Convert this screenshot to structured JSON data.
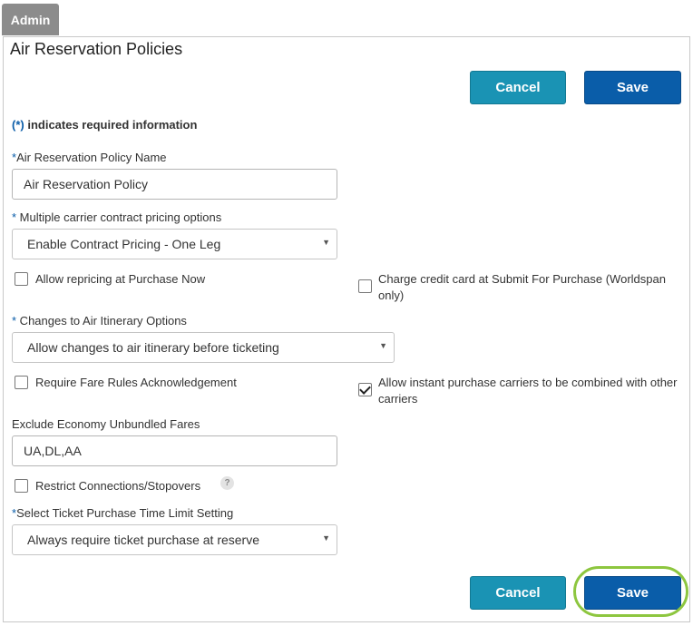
{
  "admin_tab": "Admin",
  "panel_title": "Air Reservation Policies",
  "buttons": {
    "cancel": "Cancel",
    "save": "Save"
  },
  "required_note": {
    "star": "(*)",
    "text": "indicates required information"
  },
  "fields": {
    "policy_name": {
      "asterisk": "*",
      "label": "Air Reservation Policy Name",
      "value": "Air Reservation Policy"
    },
    "contract_pricing": {
      "asterisk": "*",
      "label": " Multiple carrier contract pricing options",
      "selected": "Enable Contract Pricing - One Leg"
    },
    "allow_repricing": {
      "label": "Allow repricing at Purchase Now",
      "checked": false
    },
    "charge_credit_card": {
      "label": "Charge credit card at Submit For Purchase (Worldspan only)",
      "checked": false
    },
    "itinerary_options": {
      "asterisk": "*",
      "label": " Changes to Air Itinerary Options",
      "selected": "Allow changes to air itinerary before ticketing"
    },
    "fare_rules_ack": {
      "label": "Require Fare Rules Acknowledgement",
      "checked": false
    },
    "instant_purchase": {
      "label": "Allow instant purchase carriers to be combined with other carriers",
      "checked": true
    },
    "exclude_unbundled": {
      "label": "Exclude Economy Unbundled Fares",
      "value": "UA,DL,AA"
    },
    "restrict_connections": {
      "label": "Restrict Connections/Stopovers",
      "checked": false,
      "help_glyph": "?"
    },
    "ticket_time_limit": {
      "asterisk": "*",
      "label": "Select Ticket Purchase Time Limit Setting",
      "selected": "Always require ticket purchase at reserve"
    }
  },
  "icons": {
    "dropdown_arrow": "▼",
    "help": "question-icon"
  },
  "colors": {
    "save": "#0a5da9",
    "cancel": "#1a93b4",
    "admin_tab": "#8c8c8c",
    "highlight": "#8dc63f",
    "asterisk": "#0a5da9"
  }
}
